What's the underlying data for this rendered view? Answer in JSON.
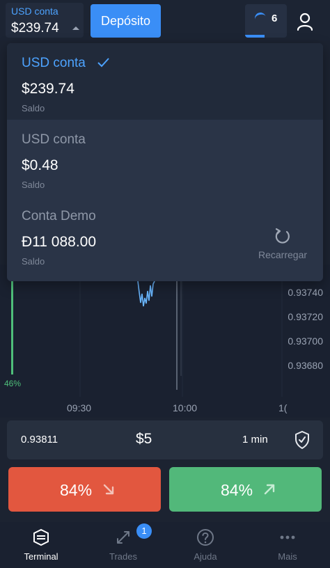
{
  "header": {
    "account_name": "USD conta",
    "account_balance": "$239.74",
    "deposit_label": "Depósito",
    "notification_count": "6"
  },
  "accounts": [
    {
      "name": "USD conta",
      "amount": "$239.74",
      "label": "Saldo",
      "selected": true
    },
    {
      "name": "USD conta",
      "amount": "$0.48",
      "label": "Saldo",
      "selected": false
    },
    {
      "name": "Conta Demo",
      "amount": "Đ11 088.00",
      "label": "Saldo",
      "selected": false
    }
  ],
  "reload_label": "Recarregar",
  "chart": {
    "price_ticks": [
      "0.93740",
      "0.93720",
      "0.93700",
      "0.93680"
    ],
    "time_ticks": [
      "09:30",
      "10:00",
      "1("
    ],
    "percent": "46%"
  },
  "trade": {
    "price": "0.93811",
    "amount": "$5",
    "duration": "1 min",
    "down_percent": "84%",
    "up_percent": "84%"
  },
  "nav": {
    "items": [
      {
        "label": "Terminal",
        "icon": "terminal-icon",
        "active": true
      },
      {
        "label": "Trades",
        "icon": "trades-icon",
        "badge": "1"
      },
      {
        "label": "Ajuda",
        "icon": "help-icon"
      },
      {
        "label": "Mais",
        "icon": "more-icon"
      }
    ]
  },
  "colors": {
    "accent": "#3a8ef6",
    "down": "#e2573f",
    "up": "#52b87a",
    "background": "#1c2331"
  }
}
